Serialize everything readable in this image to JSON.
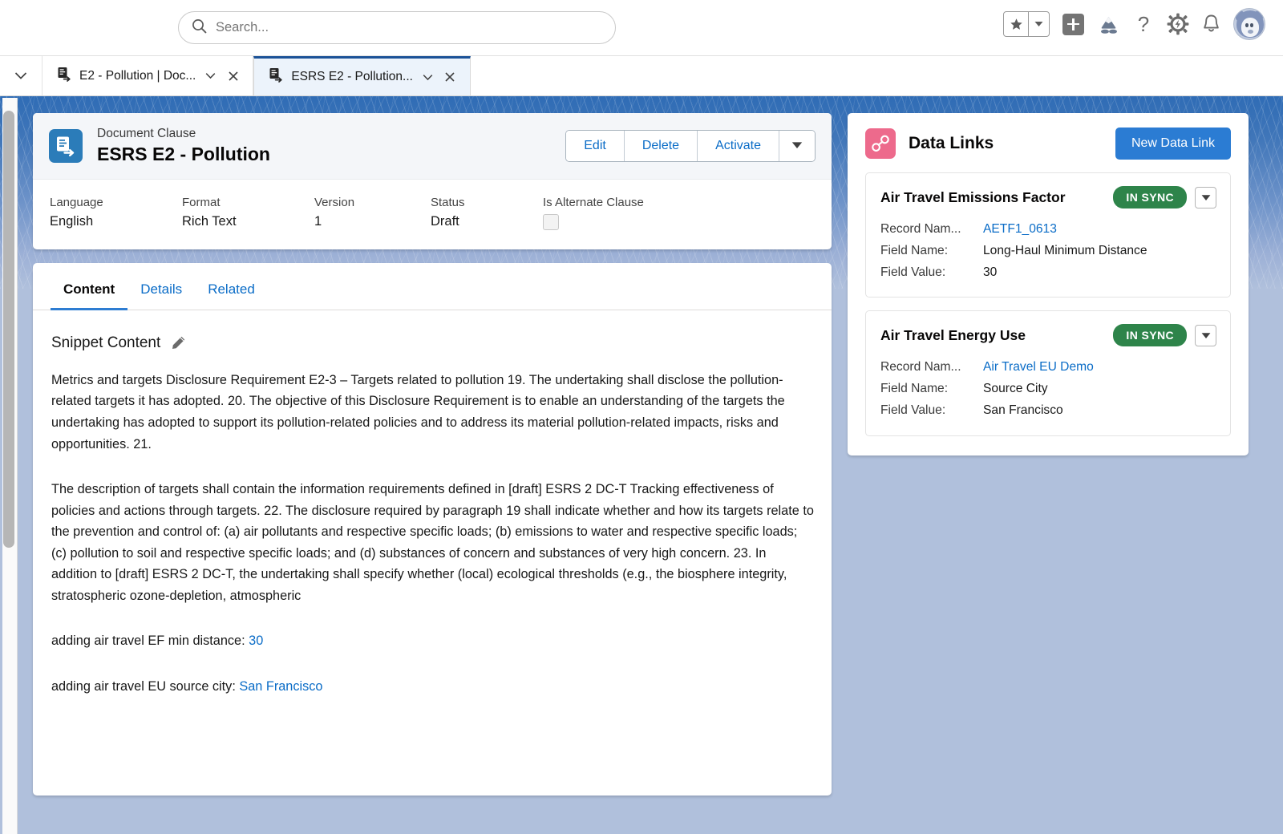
{
  "header": {
    "search": {
      "placeholder": "Search...",
      "value": "",
      "icon": "search-icon"
    },
    "icons": {
      "favorites": "star-icon",
      "favorites_caret": "chevron-down-icon",
      "add": "plus-icon",
      "app_launcher": "mountain-icon",
      "help": "question-mark-icon",
      "setup": "gear-icon",
      "notifications": "bell-icon",
      "avatar": "user-avatar"
    }
  },
  "tab_bar": {
    "overflow_caret": "chevron-down-icon",
    "tabs": [
      {
        "label": "E2 - Pollution | Doc...",
        "icon": "document-clause-icon",
        "active": false,
        "caret": "chevron-down-icon",
        "close": "close-icon"
      },
      {
        "label": "ESRS E2 - Pollution...",
        "icon": "document-clause-icon",
        "active": true,
        "caret": "chevron-down-icon",
        "close": "close-icon"
      }
    ]
  },
  "record": {
    "object_label": "Document Clause",
    "title": "ESRS E2 - Pollution",
    "icon": "document-clause-icon",
    "actions": [
      "Edit",
      "Delete",
      "Activate"
    ],
    "actions_more": "chevron-down-icon",
    "fields": [
      {
        "label": "Language",
        "value": "English",
        "type": "text"
      },
      {
        "label": "Format",
        "value": "Rich Text",
        "type": "text"
      },
      {
        "label": "Version",
        "value": "1",
        "type": "text"
      },
      {
        "label": "Status",
        "value": "Draft",
        "type": "text"
      },
      {
        "label": "Is Alternate Clause",
        "value": "",
        "type": "checkbox",
        "checked": false
      }
    ]
  },
  "content_card": {
    "tabs": [
      {
        "label": "Content",
        "active": true
      },
      {
        "label": "Details",
        "active": false
      },
      {
        "label": "Related",
        "active": false
      }
    ],
    "snippet_label": "Snippet Content",
    "edit_icon": "pencil-icon",
    "paragraphs": [
      "Metrics and targets Disclosure Requirement E2-3 – Targets related to pollution 19. The undertaking shall disclose the pollution-related targets it has adopted. 20. The objective of this Disclosure Requirement is to enable an understanding of the targets the undertaking has adopted to support its pollution-related policies and to address its material pollution-related impacts, risks and opportunities. 21.",
      "The description of targets shall contain the information requirements defined in [draft] ESRS 2 DC-T Tracking effectiveness of policies and actions through targets. 22. The disclosure required by paragraph 19 shall indicate whether and how its targets relate to the prevention and control of: (a) air pollutants and respective specific loads; (b) emissions to water and respective specific loads; (c) pollution to soil and respective specific loads; and (d) substances of concern and substances of very high concern. 23. In addition to [draft] ESRS 2 DC-T, the undertaking shall specify whether (local) ecological thresholds (e.g., the biosphere integrity, stratospheric ozone-depletion, atmospheric"
    ],
    "bound_lines": [
      {
        "text": "adding air travel EF min distance: ",
        "value": "30"
      },
      {
        "text": "adding air travel EU source city: ",
        "value": "San Francisco"
      }
    ]
  },
  "data_links": {
    "title": "Data Links",
    "icon": "data-link-icon",
    "new_button": "New Data Link",
    "row_labels": {
      "record_name": "Record Nam...",
      "field_name": "Field Name:",
      "field_value": "Field Value:"
    },
    "items": [
      {
        "title": "Air Travel Emissions Factor",
        "status": "IN SYNC",
        "caret": "chevron-down-icon",
        "record_name": "AETF1_0613",
        "field_name": "Long-Haul Minimum Distance",
        "field_value": "30"
      },
      {
        "title": "Air Travel Energy Use",
        "status": "IN SYNC",
        "caret": "chevron-down-icon",
        "record_name": "Air Travel EU Demo",
        "field_name": "Source City",
        "field_value": "San Francisco"
      }
    ]
  },
  "colors": {
    "brand_blue": "#2b7cd3",
    "link_blue": "#0a6cc7",
    "success_green": "#2e844a",
    "datalink_pink": "#ed6a8c",
    "page_background": "#b0c0dc",
    "record_icon_blue": "#2b7cb9"
  }
}
